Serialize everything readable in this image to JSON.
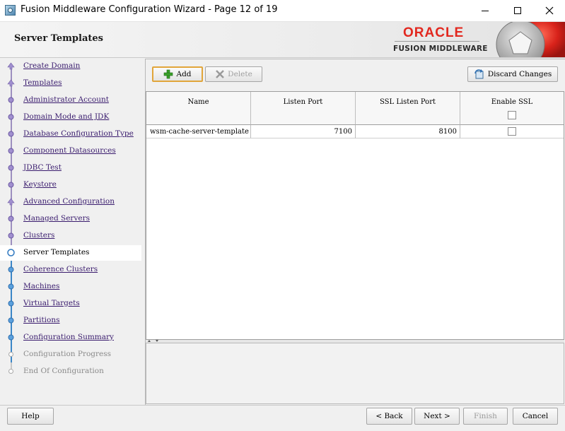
{
  "window": {
    "title": "Fusion Middleware Configuration Wizard - Page 12 of 19",
    "icon": "wizard-app-icon",
    "controls": [
      "minimize-icon",
      "maximize-icon",
      "close-icon"
    ]
  },
  "header": {
    "page_title": "Server Templates",
    "brand": "ORACLE",
    "brand_sub": "FUSION MIDDLEWARE",
    "brand_color": "#e2281f"
  },
  "nav": {
    "items": [
      {
        "label": "Create Domain",
        "state": "done"
      },
      {
        "label": "Templates",
        "state": "done"
      },
      {
        "label": "Administrator Account",
        "state": "done"
      },
      {
        "label": "Domain Mode and JDK",
        "state": "done"
      },
      {
        "label": "Database Configuration Type",
        "state": "done"
      },
      {
        "label": "Component Datasources",
        "state": "done"
      },
      {
        "label": "JDBC Test",
        "state": "done"
      },
      {
        "label": "Keystore",
        "state": "done"
      },
      {
        "label": "Advanced Configuration",
        "state": "done"
      },
      {
        "label": "Managed Servers",
        "state": "done"
      },
      {
        "label": "Clusters",
        "state": "done"
      },
      {
        "label": "Server Templates",
        "state": "active"
      },
      {
        "label": "Coherence Clusters",
        "state": "pending"
      },
      {
        "label": "Machines",
        "state": "pending"
      },
      {
        "label": "Virtual Targets",
        "state": "pending"
      },
      {
        "label": "Partitions",
        "state": "pending"
      },
      {
        "label": "Configuration Summary",
        "state": "pending"
      },
      {
        "label": "Configuration Progress",
        "state": "disabled"
      },
      {
        "label": "End Of Configuration",
        "state": "disabled"
      }
    ]
  },
  "toolbar": {
    "add_label": "Add",
    "delete_label": "Delete",
    "discard_label": "Discard Changes"
  },
  "table": {
    "columns": [
      "Name",
      "Listen Port",
      "SSL Listen Port",
      "Enable SSL"
    ],
    "rows": [
      {
        "name": "wsm-cache-server-template",
        "listen_port": "7100",
        "ssl_listen_port": "8100",
        "enable_ssl": false
      }
    ]
  },
  "footer": {
    "help_label": "Help",
    "back_label": "< Back",
    "next_label": "Next >",
    "finish_label": "Finish",
    "cancel_label": "Cancel"
  }
}
